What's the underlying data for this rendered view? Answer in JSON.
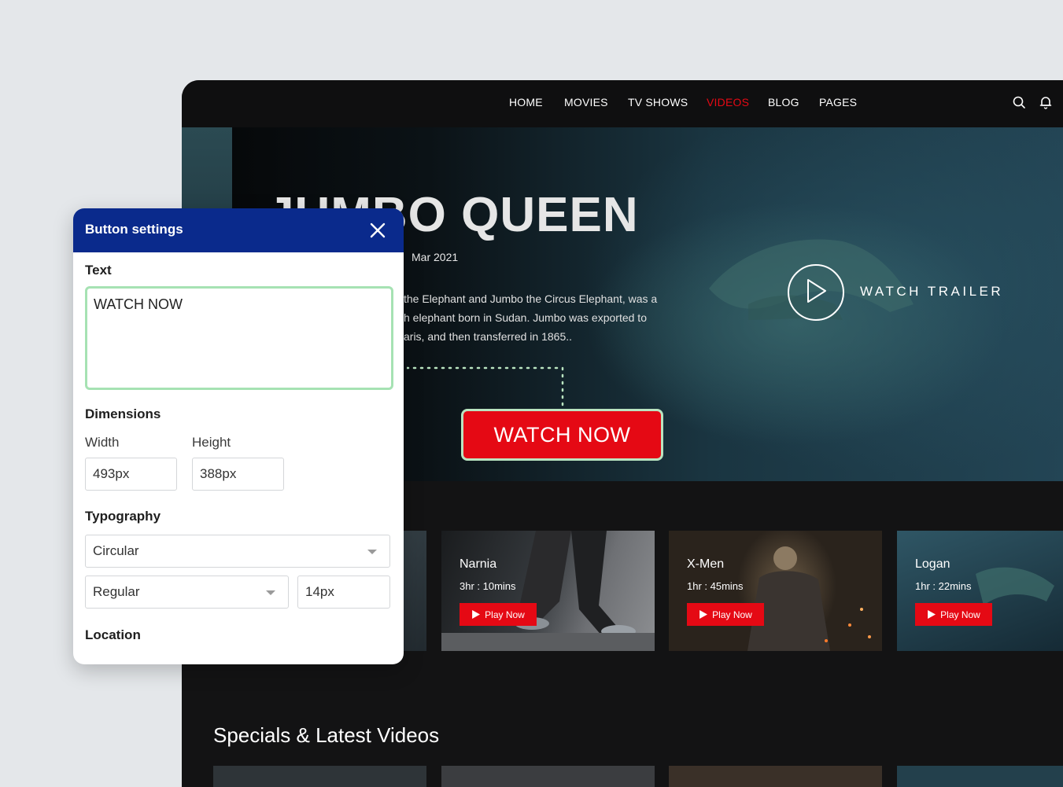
{
  "nav": {
    "links": [
      "HOME",
      "MOVIES",
      "TV SHOWS",
      "VIDEOS",
      "BLOG",
      "PAGES"
    ],
    "active": "VIDEOS",
    "icons": [
      "search-icon",
      "bell-icon"
    ]
  },
  "hero": {
    "title": "JUMBO QUEEN",
    "date": "Mar 2021",
    "description": [
      "the Elephant and Jumbo the Circus Elephant, was a",
      "h elephant born in Sudan. Jumbo was exported to",
      "aris, and then transferred in 1865.."
    ],
    "trailer_label": "WATCH TRAILER",
    "cta_label": "WATCH NOW"
  },
  "cards": [
    {
      "title": "Narnia",
      "duration": "3hr : 10mins",
      "button": "Play Now"
    },
    {
      "title": "X-Men",
      "duration": "1hr : 45mins",
      "button": "Play Now"
    },
    {
      "title": "Logan",
      "duration": "1hr : 22mins",
      "button": "Play Now"
    }
  ],
  "section": {
    "title": "Specials & Latest Videos"
  },
  "panel": {
    "title": "Button settings",
    "text_label": "Text",
    "text_value": "WATCH NOW",
    "dimensions_label": "Dimensions",
    "width_label": "Width",
    "width_value": "493px",
    "height_label": "Height",
    "height_value": "388px",
    "typography_label": "Typography",
    "font_family": "Circular",
    "font_weight": "Regular",
    "font_size": "14px",
    "location_label": "Location"
  },
  "colors": {
    "accent_red": "#e50914",
    "panel_header": "#0a2a8c",
    "highlight_green": "#a6e2b3"
  }
}
